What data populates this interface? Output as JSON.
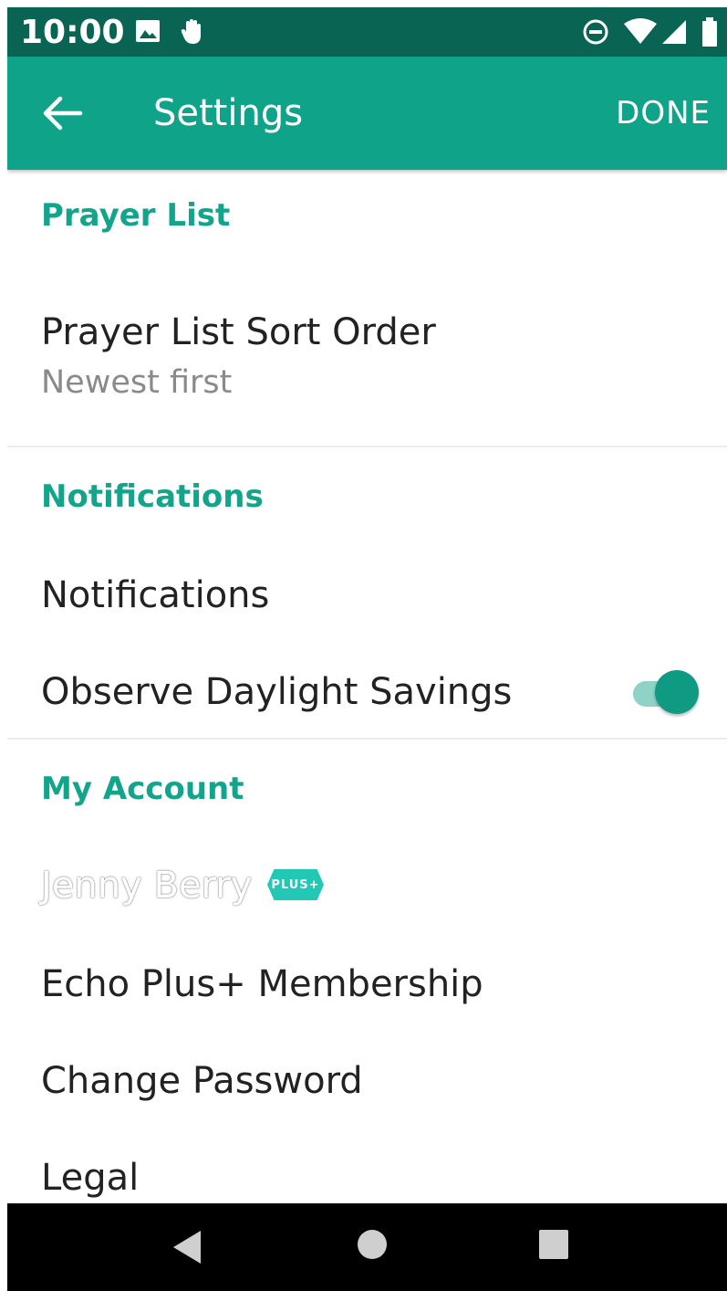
{
  "status_bar": {
    "time": "10:00",
    "icons": [
      "image-icon",
      "hand-icon",
      "do-not-disturb-icon",
      "wifi-icon",
      "signal-icon",
      "battery-icon"
    ],
    "background": "#0a6453"
  },
  "app_bar": {
    "title": "Settings",
    "back_icon": "arrow-left-icon",
    "done_label": "DONE",
    "background": "#0fa38a"
  },
  "sections": {
    "prayer_list": {
      "header": "Prayer List",
      "sort_order": {
        "label": "Prayer List Sort Order",
        "value": "Newest first"
      }
    },
    "notifications": {
      "header": "Notifications",
      "notifications_label": "Notifications",
      "daylight_savings": {
        "label": "Observe Daylight Savings",
        "enabled": true
      }
    },
    "my_account": {
      "header": "My Account",
      "user_name": "Jenny Berry",
      "badge": "PLUS+",
      "membership_label": "Echo Plus+ Membership",
      "change_password_label": "Change Password",
      "legal_label": "Legal"
    }
  },
  "nav_bar": {
    "icons": [
      "nav-back-icon",
      "nav-home-icon",
      "nav-recents-icon"
    ]
  },
  "colors": {
    "accent": "#12a58c",
    "toggle_on": "#0f9b83",
    "badge": "#22c8b3"
  }
}
